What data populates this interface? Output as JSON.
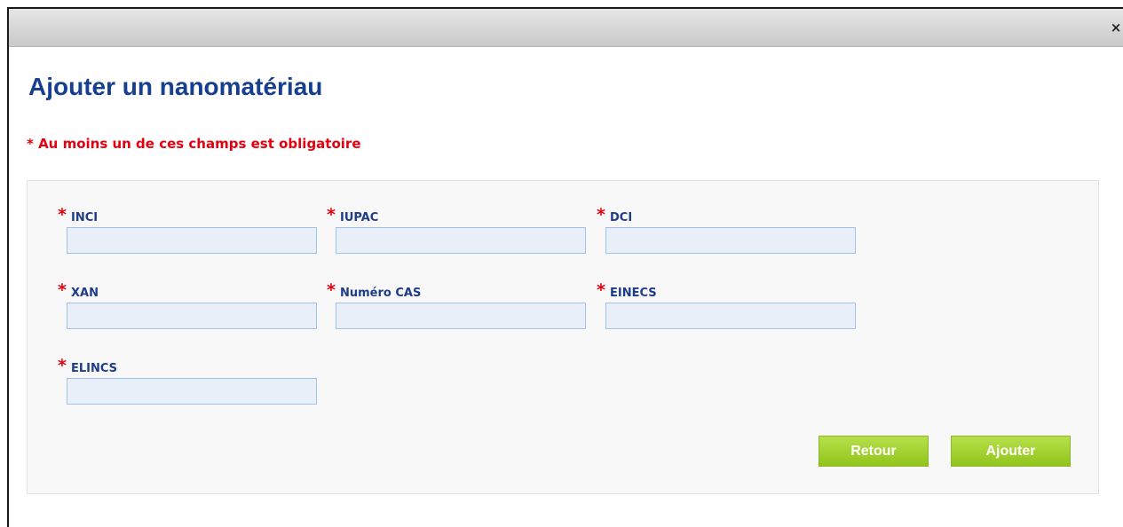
{
  "dialog": {
    "close_icon": "×",
    "title": "Ajouter un nanomatériau",
    "required_note": "* Au moins un de ces champs est obligatoire"
  },
  "form": {
    "required_marker": "*",
    "fields": [
      {
        "label": "INCI",
        "value": "",
        "placeholder": ""
      },
      {
        "label": "IUPAC",
        "value": "",
        "placeholder": ""
      },
      {
        "label": "DCI",
        "value": "",
        "placeholder": ""
      },
      {
        "label": "XAN",
        "value": "",
        "placeholder": ""
      },
      {
        "label": "Numéro CAS",
        "value": "",
        "placeholder": ""
      },
      {
        "label": "EINECS",
        "value": "",
        "placeholder": ""
      },
      {
        "label": "ELINCS",
        "value": "",
        "placeholder": ""
      }
    ],
    "buttons": {
      "back": "Retour",
      "add": "Ajouter"
    }
  },
  "colors": {
    "title": "#173f8f",
    "required": "#e3000f",
    "field_label": "#1f3c88",
    "input_bg": "#e8eff8",
    "input_border": "#9fc3e6",
    "button_green": "#a3d22f"
  }
}
